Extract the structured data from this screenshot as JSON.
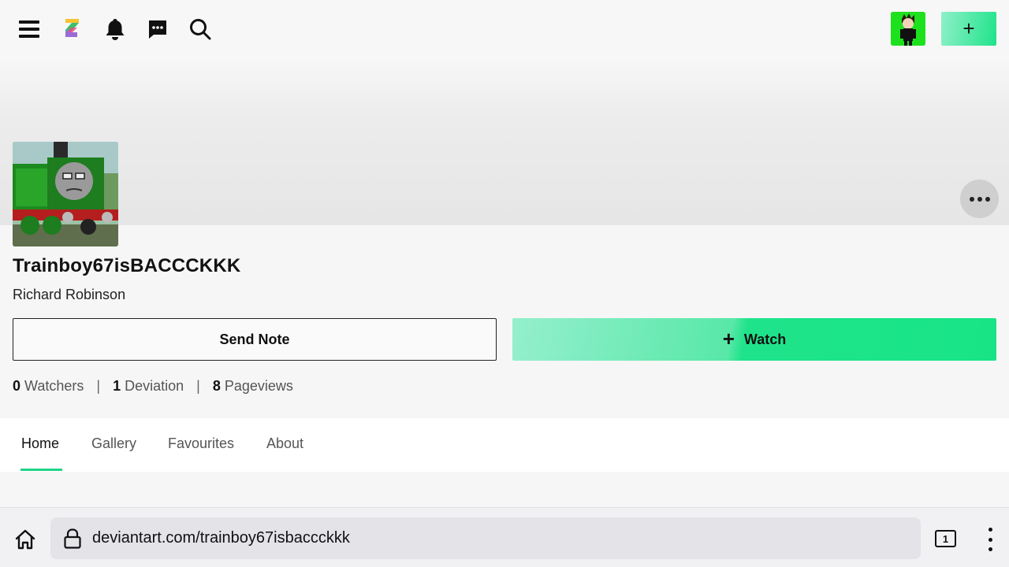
{
  "header": {
    "menu_icon": "hamburger-icon",
    "logo_icon": "deviantart-logo-icon",
    "notifications_icon": "bell-icon",
    "messages_icon": "chat-icon",
    "search_icon": "search-icon",
    "create_label": "+"
  },
  "profile": {
    "username": "Trainboy67isBACCCKKK",
    "real_name": "Richard Robinson",
    "more_icon": "more-horizontal-icon"
  },
  "actions": {
    "send_note_label": "Send Note",
    "watch_plus": "+",
    "watch_label": "Watch"
  },
  "stats": [
    {
      "count": "0",
      "label": "Watchers"
    },
    {
      "count": "1",
      "label": "Deviation"
    },
    {
      "count": "8",
      "label": "Pageviews"
    }
  ],
  "stats_separator": "|",
  "tabs": [
    {
      "label": "Home",
      "active": true
    },
    {
      "label": "Gallery",
      "active": false
    },
    {
      "label": "Favourites",
      "active": false
    },
    {
      "label": "About",
      "active": false
    }
  ],
  "browser": {
    "url": "deviantart.com/trainboy67isbaccckkk",
    "tab_count": "1",
    "home_icon": "home-icon",
    "lock_icon": "lock-icon",
    "menu_icon": "vertical-dots-icon"
  },
  "colors": {
    "accent": "#1fe38a",
    "avatar_bg": "#1ee11e"
  }
}
